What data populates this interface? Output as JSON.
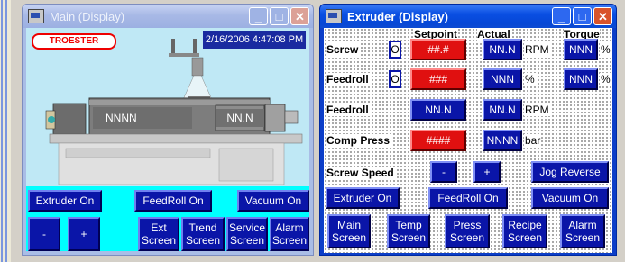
{
  "main_window": {
    "title": "Main (Display)",
    "logo": "TROESTER",
    "datetime": "2/16/2006 4:47:08 PM",
    "screw_display": "NNNN",
    "speed_display": "NN.N",
    "buttons": {
      "extruder_on": "Extruder On",
      "feedroll_on": "FeedRoll On",
      "vacuum_on": "Vacuum On",
      "minus": "-",
      "plus": "+",
      "ext_screen": "Ext Screen",
      "trend_screen": "Trend Screen",
      "service_screen": "Service Screen",
      "alarm_screen": "Alarm Screen"
    }
  },
  "extruder_window": {
    "title": "Extruder (Display)",
    "headers": {
      "setpoint": "Setpoint",
      "actual": "Actual",
      "torque": "Torque"
    },
    "rows": {
      "screw": {
        "label": "Screw",
        "mode": "O",
        "setpoint": "##.#",
        "actual": "NN.N",
        "unit": "RPM",
        "torque": "NNN",
        "torque_unit": "%"
      },
      "feedroll1": {
        "label": "Feedroll",
        "mode": "O",
        "setpoint": "###",
        "actual": "NNN",
        "unit": "%",
        "torque": "NNN",
        "torque_unit": "%"
      },
      "feedroll2": {
        "label": "Feedroll",
        "setpoint": "NN.N",
        "actual": "NN.N",
        "unit": "RPM"
      },
      "comp_press": {
        "label": "Comp Press",
        "setpoint": "####",
        "actual": "NNNN",
        "unit": "bar"
      }
    },
    "screw_speed": {
      "label": "Screw Speed",
      "minus": "-",
      "plus": "+",
      "jog_reverse": "Jog Reverse"
    },
    "controls": {
      "extruder_on": "Extruder On",
      "feedroll_on": "FeedRoll On",
      "vacuum_on": "Vacuum On"
    },
    "nav": {
      "main": "Main Screen",
      "temp": "Temp Screen",
      "press": "Press Screen",
      "recipe": "Recipe Screen",
      "alarm": "Alarm Screen"
    }
  },
  "icons": [
    "app-icon",
    "minimize-icon",
    "maximize-icon",
    "close-icon"
  ]
}
